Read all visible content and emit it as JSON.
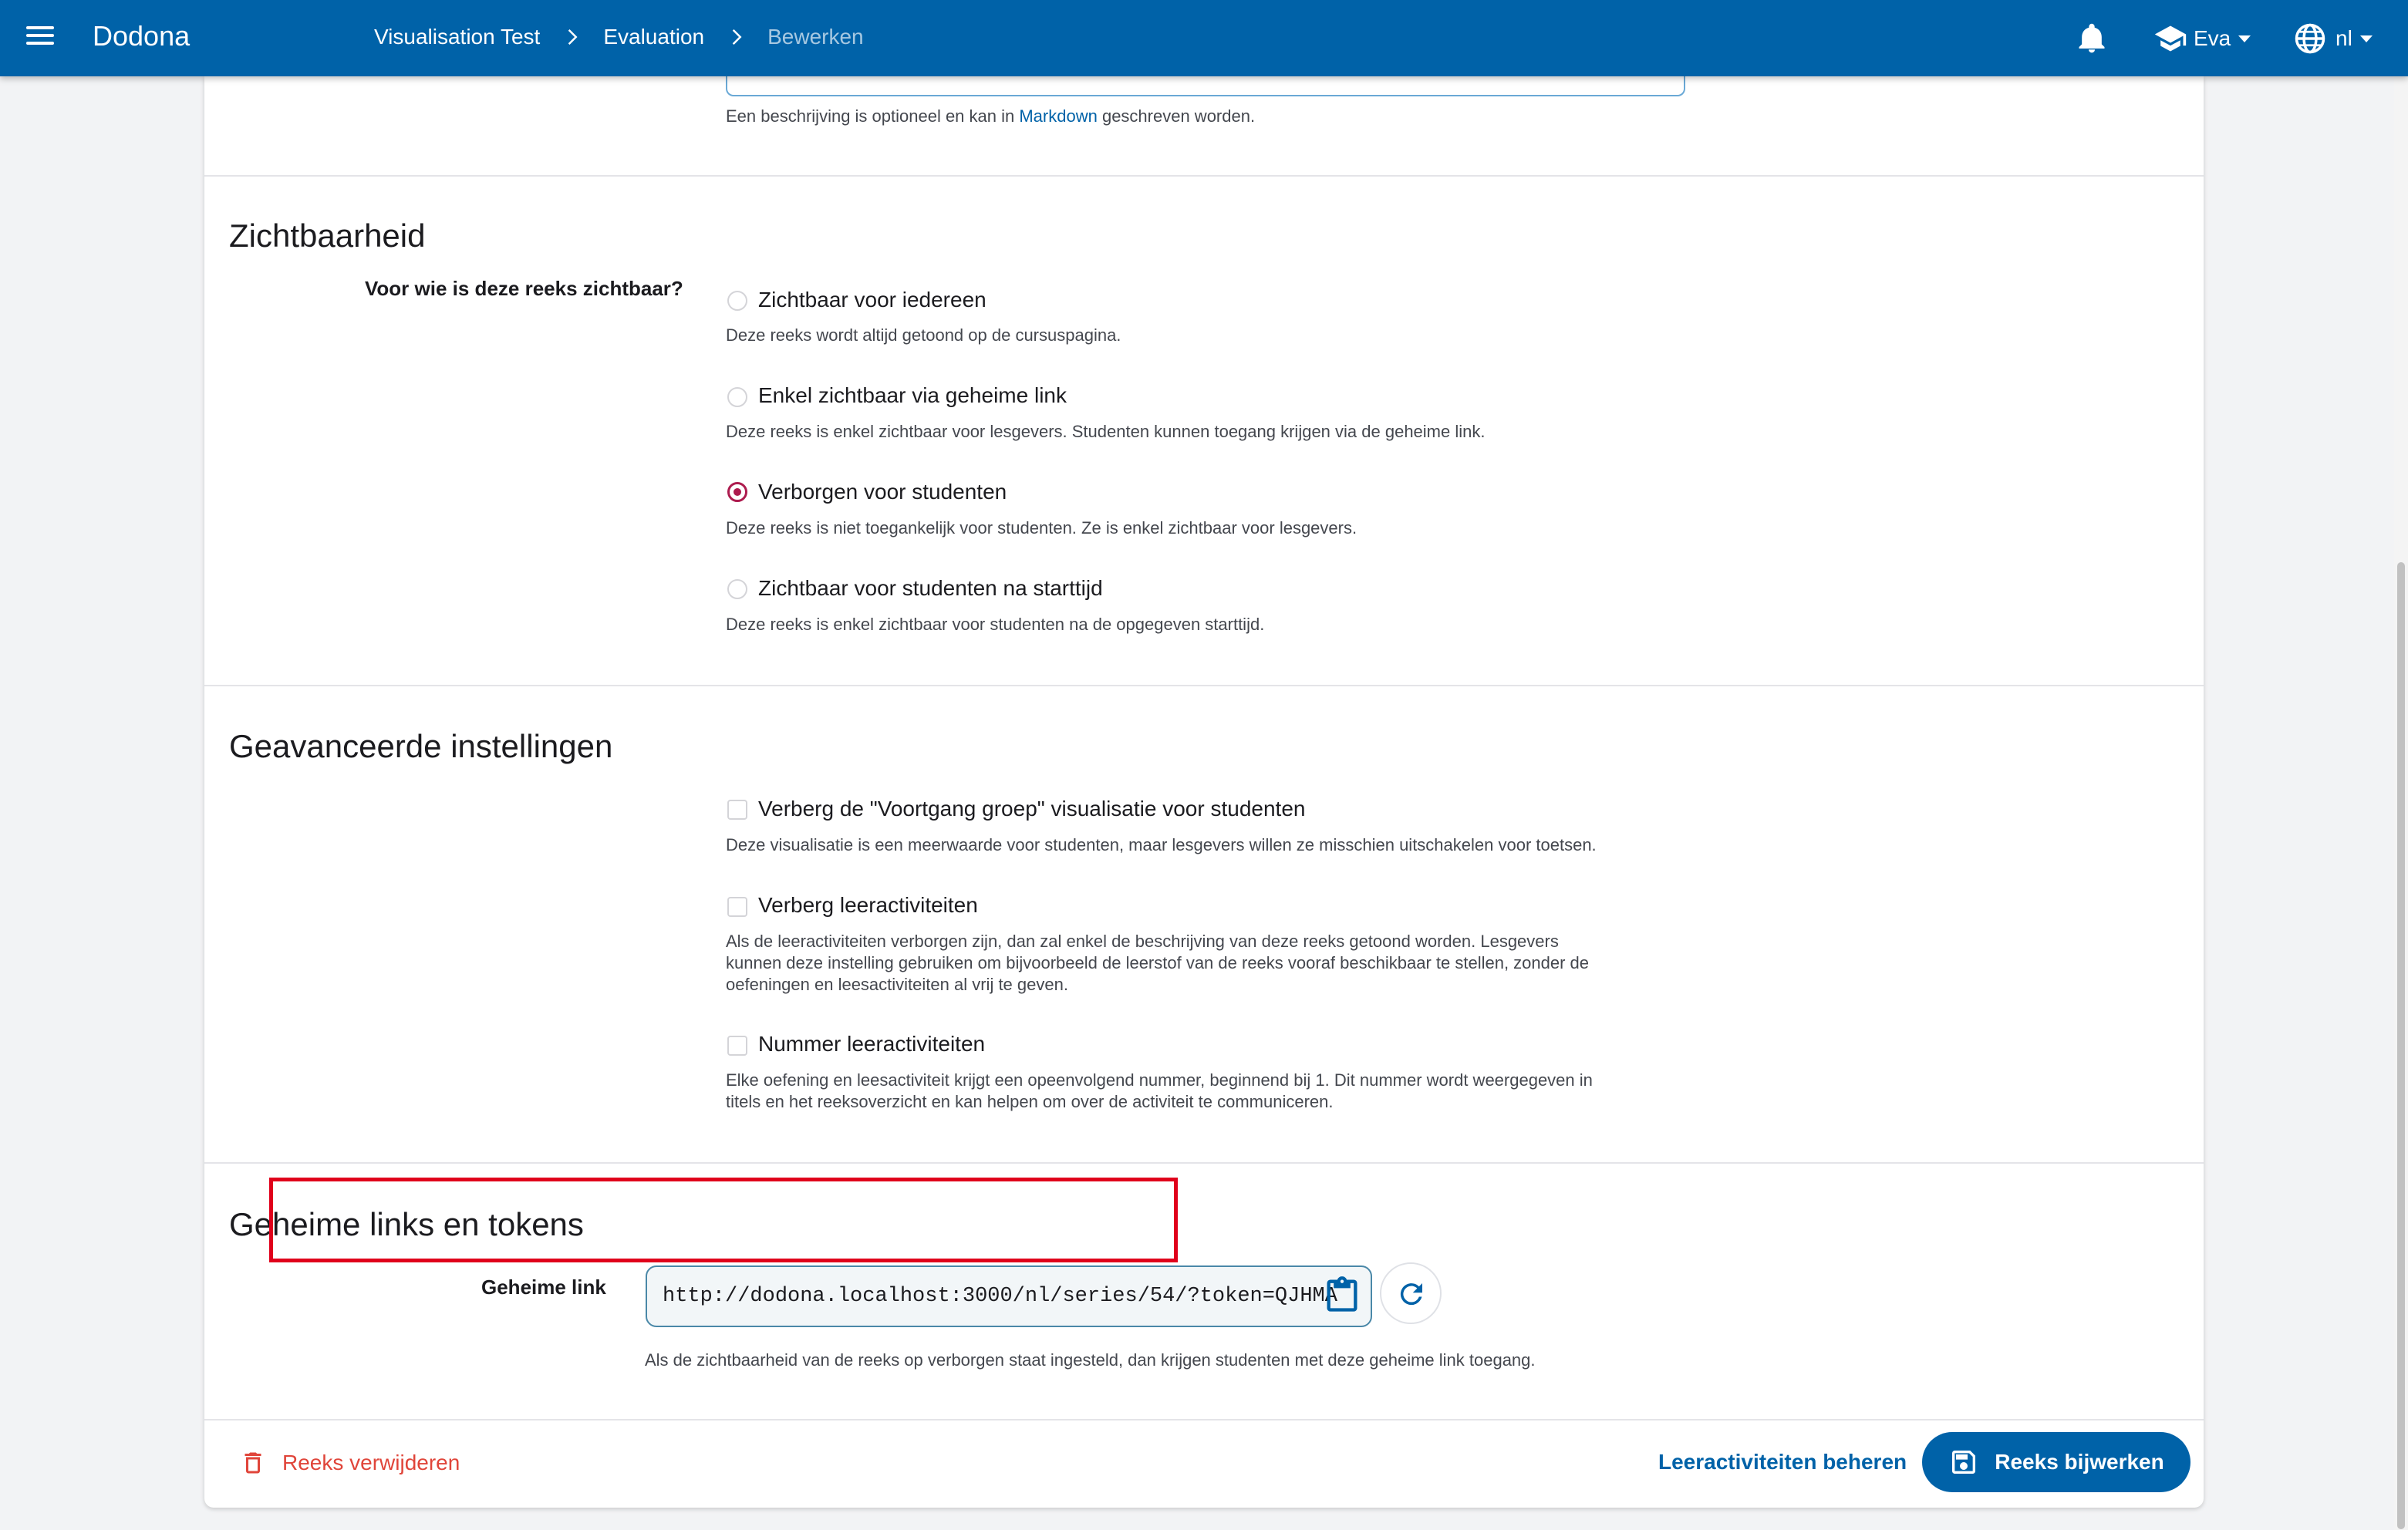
{
  "app": {
    "brand": "Dodona"
  },
  "breadcrumbs": [
    "Visualisation Test",
    "Evaluation",
    "Bewerken"
  ],
  "user": {
    "name": "Eva"
  },
  "language": {
    "code": "nl"
  },
  "description": {
    "help_prefix": "Een beschrijving is optioneel en kan in ",
    "help_link": "Markdown",
    "help_suffix": " geschreven worden."
  },
  "visibility": {
    "title": "Zichtbaarheid",
    "question": "Voor wie is deze reeks zichtbaar?",
    "selected": "hidden",
    "options": [
      {
        "id": "open",
        "label": "Zichtbaar voor iedereen",
        "help": "Deze reeks wordt altijd getoond op de cursuspagina."
      },
      {
        "id": "secret",
        "label": "Enkel zichtbaar via geheime link",
        "help": "Deze reeks is enkel zichtbaar voor lesgevers. Studenten kunnen toegang krijgen via de geheime link."
      },
      {
        "id": "hidden",
        "label": "Verborgen voor studenten",
        "help": "Deze reeks is niet toegankelijk voor studenten. Ze is enkel zichtbaar voor lesgevers."
      },
      {
        "id": "timed",
        "label": "Zichtbaar voor studenten na starttijd",
        "help": "Deze reeks is enkel zichtbaar voor studenten na de opgegeven starttijd."
      }
    ]
  },
  "advanced": {
    "title": "Geavanceerde instellingen",
    "options": [
      {
        "label": "Verberg de \"Voortgang groep\" visualisatie voor studenten",
        "checked": false,
        "help": [
          "Deze visualisatie is een meerwaarde voor studenten, maar lesgevers willen ze misschien uitschakelen voor toetsen."
        ]
      },
      {
        "label": "Verberg leeractiviteiten",
        "checked": false,
        "help": [
          "Als de leeractiviteiten verborgen zijn, dan zal enkel de beschrijving van deze reeks getoond worden. Lesgevers",
          "kunnen deze instelling gebruiken om bijvoorbeeld de leerstof van de reeks vooraf beschikbaar te stellen, zonder de",
          "oefeningen en leesactiviteiten al vrij te geven."
        ]
      },
      {
        "label": "Nummer leeractiviteiten",
        "checked": false,
        "help": [
          "Elke oefening en leesactiviteit krijgt een opeenvolgend nummer, beginnend bij 1. Dit nummer wordt weergegeven in",
          "titels en het reeksoverzicht en kan helpen om over de activiteit te communiceren."
        ]
      }
    ]
  },
  "secret": {
    "title": "Geheime links en tokens",
    "label": "Geheime link",
    "value": "http://dodona.localhost:3000/nl/series/54/?token=QJHMA",
    "help": "Als de zichtbaarheid van de reeks op verborgen staat ingesteld, dan krijgen studenten met deze geheime link toegang."
  },
  "footer": {
    "delete_label": "Reeks verwijderen",
    "manage_label": "Leeractiviteiten beheren",
    "update_label": "Reeks bijwerken"
  },
  "colors": {
    "primary": "#0062a8",
    "radio_checked": "#ad1b4e",
    "danger": "#e0453a",
    "highlight": "#e0001b"
  }
}
